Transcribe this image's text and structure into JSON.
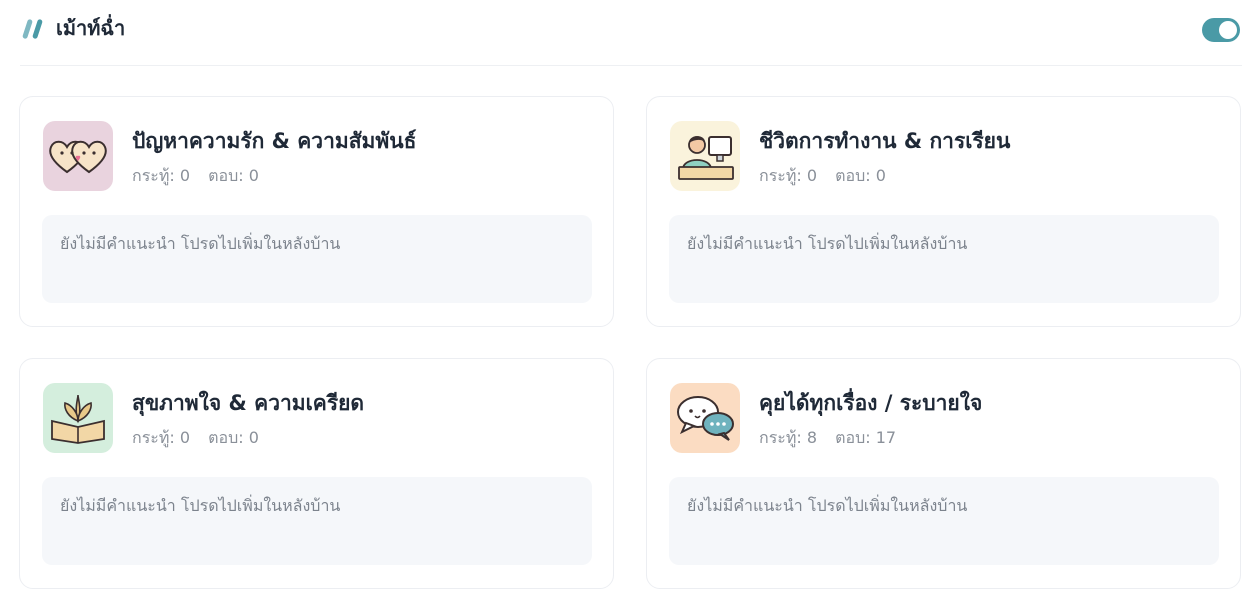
{
  "header": {
    "title": "เม้าท์ฉ่ำ",
    "toggle_on": true,
    "accent_color": "#4a9aa6"
  },
  "categories": [
    {
      "title": "ปัญหาความรัก & ความสัมพันธ์",
      "topics": "กระทู้: 0",
      "replies": "ตอบ: 0",
      "notice": "ยังไม่มีคำแนะนำ โปรดไปเพิ่มในหลังบ้าน",
      "icon": "hearts-icon",
      "icon_bg": "#e9d3de"
    },
    {
      "title": "ชีวิตการทำงาน & การเรียน",
      "topics": "กระทู้: 0",
      "replies": "ตอบ: 0",
      "notice": "ยังไม่มีคำแนะนำ โปรดไปเพิ่มในหลังบ้าน",
      "icon": "person-at-computer-icon",
      "icon_bg": "#faf3dc"
    },
    {
      "title": "สุขภาพใจ & ความเครียด",
      "topics": "กระทู้: 0",
      "replies": "ตอบ: 0",
      "notice": "ยังไม่มีคำแนะนำ โปรดไปเพิ่มในหลังบ้าน",
      "icon": "book-plant-icon",
      "icon_bg": "#d4eedd"
    },
    {
      "title": "คุยได้ทุกเรื่อง / ระบายใจ",
      "topics": "กระทู้: 8",
      "replies": "ตอบ: 17",
      "notice": "ยังไม่มีคำแนะนำ โปรดไปเพิ่มในหลังบ้าน",
      "icon": "chat-bubbles-icon",
      "icon_bg": "#fbdcc2"
    }
  ]
}
